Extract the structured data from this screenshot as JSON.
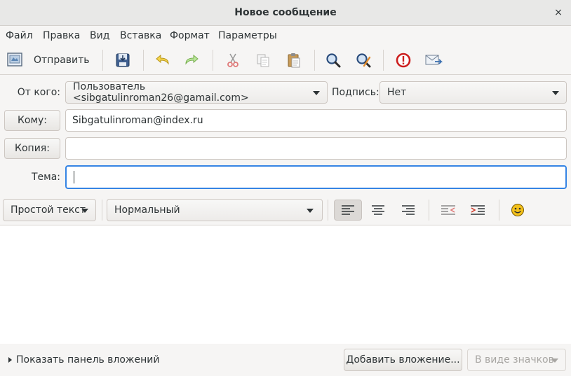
{
  "window": {
    "title": "Новое сообщение",
    "close_glyph": "×"
  },
  "menu": [
    "Файл",
    "Правка",
    "Вид",
    "Вставка",
    "Формат",
    "Параметры"
  ],
  "toolbar": {
    "send_label": "Отправить",
    "icons": [
      "send-icon",
      "save-icon",
      "undo-icon",
      "redo-icon",
      "cut-icon",
      "copy-icon",
      "paste-icon",
      "find-icon",
      "find-replace-icon",
      "priority-icon",
      "return-receipt-icon"
    ]
  },
  "header": {
    "from_label": "От кого:",
    "from_value": "Пользователь <sibgatulinroman26@gamail.com>",
    "signature_label": "Подпись:",
    "signature_value": "Нет",
    "to_button": "Кому:",
    "to_value": "Sibgatulinroman@index.ru",
    "cc_button": "Копия:",
    "cc_value": "",
    "subject_label": "Тема:",
    "subject_value": ""
  },
  "format": {
    "mode": "Простой текст",
    "paragraph_style": "Нормальный",
    "alignment_active": "left",
    "icons": [
      "align-left-icon",
      "align-center-icon",
      "align-right-icon",
      "unindent-icon",
      "indent-icon",
      "emoticon-icon"
    ]
  },
  "body": {
    "text": ""
  },
  "attachments": {
    "toggle_label": "Показать панель вложений",
    "add_button": "Добавить вложение...",
    "view_mode": "В виде значков"
  },
  "colors": {
    "accent": "#3584e4",
    "titlebar": "#e8e8e7",
    "background": "#f6f5f4"
  }
}
